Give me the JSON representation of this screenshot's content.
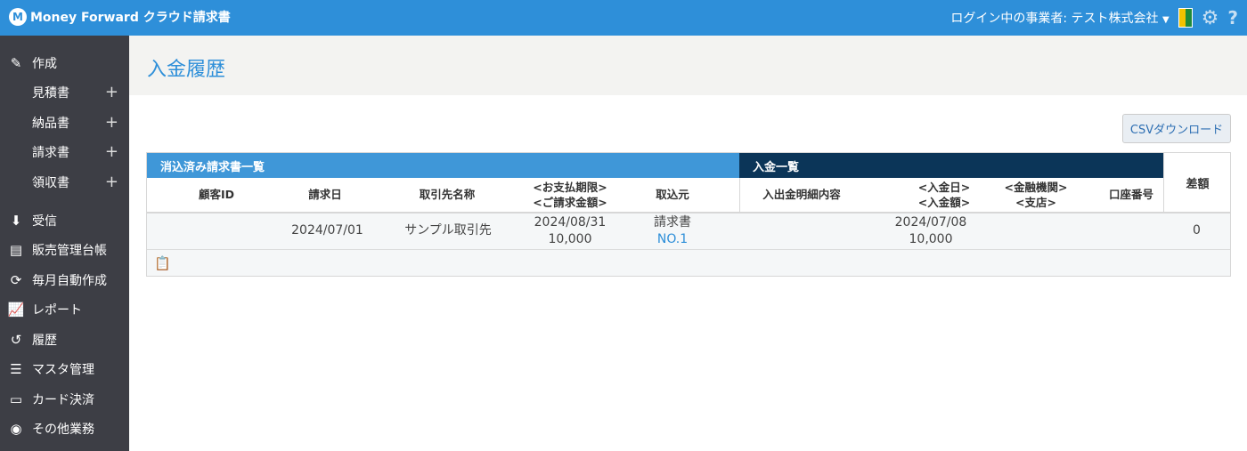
{
  "header": {
    "logo_text": "Money Forward クラウド請求書",
    "login_label": "ログイン中の事業者: テスト株式会社"
  },
  "sidebar": {
    "items": [
      {
        "label": "作成",
        "icon": "pencil-icon"
      },
      {
        "label": "見積書",
        "sub": true
      },
      {
        "label": "納品書",
        "sub": true
      },
      {
        "label": "請求書",
        "sub": true
      },
      {
        "label": "領収書",
        "sub": true
      },
      {
        "label": "受信",
        "icon": "inbox-icon"
      },
      {
        "label": "販売管理台帳",
        "icon": "book-icon"
      },
      {
        "label": "毎月自動作成",
        "icon": "refresh-icon"
      },
      {
        "label": "レポート",
        "icon": "chart-icon"
      },
      {
        "label": "履歴",
        "icon": "history-icon"
      },
      {
        "label": "マスタ管理",
        "icon": "list-icon"
      },
      {
        "label": "カード決済",
        "icon": "card-icon"
      },
      {
        "label": "その他業務",
        "icon": "mf-logo-icon"
      }
    ]
  },
  "page": {
    "title": "入金履歴",
    "csv_button": "CSVダウンロード"
  },
  "table": {
    "left_header": "消込済み請求書一覧",
    "right_header": "入金一覧",
    "diff_header": "差額",
    "columns": {
      "customer_id": "顧客ID",
      "invoice_date": "請求日",
      "partner": "取引先名称",
      "due_line1": "<お支払期限>",
      "due_line2": "<ご請求金額>",
      "source": "取込元",
      "detail": "入出金明細内容",
      "pay_line1": "<入金日>",
      "pay_line2": "<入金額>",
      "bank_line1": "<金融機関>",
      "bank_line2": "<支店>",
      "account": "口座番号"
    },
    "row": {
      "customer_id": "",
      "invoice_date": "2024/07/01",
      "partner": "サンプル取引先",
      "due_date": "2024/08/31",
      "invoice_amount": "10,000",
      "source_type": "請求書",
      "source_no": "NO.1",
      "pay_date": "2024/07/08",
      "pay_amount": "10,000",
      "diff": "0"
    }
  }
}
